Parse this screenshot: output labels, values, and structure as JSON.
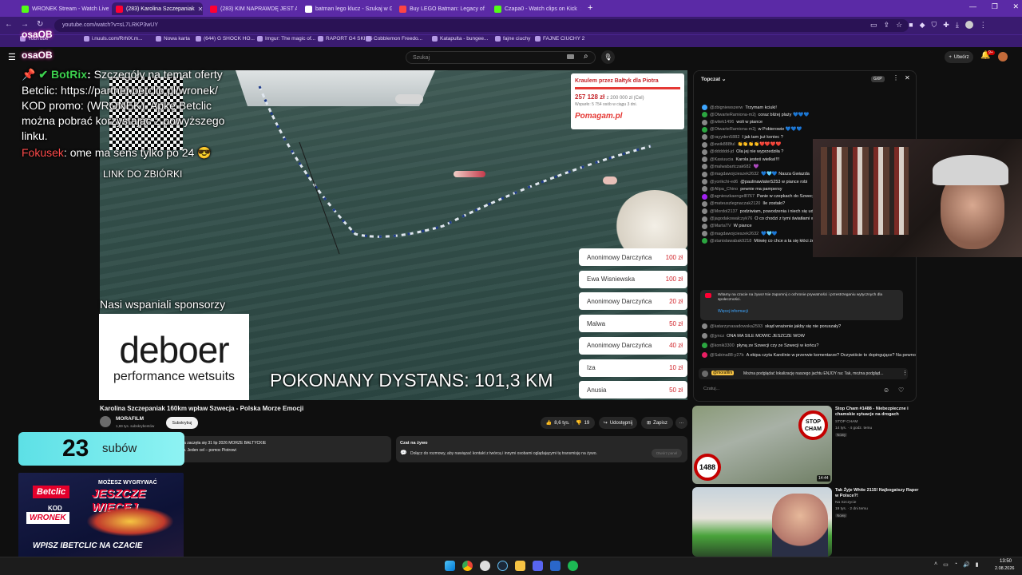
{
  "browser": {
    "tabs": [
      {
        "label": "WRONEK Stream - Watch Live o",
        "color": "#53fc18"
      },
      {
        "label": "(283) Karolina Szczepaniak",
        "color": "#ff0033"
      },
      {
        "label": "(283) KIM NAPRAWDĘ JEST ALB",
        "color": "#ff0033"
      },
      {
        "label": "batman lego klucz - Szukaj w G",
        "color": "#ffffff"
      },
      {
        "label": "Buy LEGO Batman: Legacy of th",
        "color": "#ff4444"
      },
      {
        "label": "Czapa0 - Watch clips on Kick",
        "color": "#53fc18"
      }
    ],
    "new_tab": "+",
    "url": "youtube.com/watch?v=sL7LRKP3wUY",
    "bookmarks": [
      "YouTube",
      "i.nuuls.com/RrhlX.m...",
      "Nowa karta",
      "(644) G SHOCK HO...",
      "Imgur: The magic of...",
      "RAPORT G4 SKINS",
      "Cobblemon Freedo...",
      "Katapulta - bungee...",
      "fajne ciuchy",
      "FAJNE CIUCHY 2"
    ]
  },
  "youtube": {
    "search_placeholder": "Szukaj",
    "create_label": "Utwórz",
    "notif_count": "9+",
    "logo_text": "osaOB"
  },
  "overlay": {
    "bot_name": "BotRix",
    "bot_msg_lines": [
      "Szczegóły na temat oferty",
      "Betclic: https://partner.betclic.pl/wronek/",
      "KOD promo: (WRONEK). Apkę Betclic",
      "można pobrać korzystając z powyższego",
      "linku."
    ],
    "user2_name": "Fokusek",
    "user2_msg": "ome ma sens tylko po 24",
    "qr_caption": "LINK DO ZBIÓRKI",
    "sponsors_text": "Nasi wspaniali sponsorzy",
    "sponsor_logo_main": "deboer",
    "sponsor_logo_sub": "performance wetsuits",
    "distance_text": "POKONANY DYSTANS: 101,3 KM",
    "subs_count": "23",
    "subs_label": "subów",
    "betclic_brand": "Betclic",
    "betclic_code_label": "KOD",
    "betclic_code": "WRONEK",
    "betclic_headline": "MOŻESZ WYGRYWAĆ",
    "betclic_headline2": "JESZCZE WIĘCEJ",
    "betclic_footer": "WPISZ IBETCLIC NA CZACIE"
  },
  "fundraiser": {
    "title": "Kraulem przez Bałtyk dla Piotra",
    "raised": "257 128 zł",
    "goal": "z 200 000 zł (Cel)",
    "supporters": "Wsparło: 5 754 osób w ciągu 3 dni.",
    "brand": "Pomagam.pl",
    "progress": 1.0,
    "donations": [
      {
        "name": "Anonimowy Darczyńca",
        "amount": "100 zł"
      },
      {
        "name": "Ewa Wisniewska",
        "amount": "100 zł"
      },
      {
        "name": "Anonimowy Darczyńca",
        "amount": "20 zł"
      },
      {
        "name": "Malwa",
        "amount": "50 zł"
      },
      {
        "name": "Anonimowy Darczyńca",
        "amount": "40 zł"
      },
      {
        "name": "Iza",
        "amount": "10 zł"
      },
      {
        "name": "Anusia",
        "amount": "50 zł"
      }
    ]
  },
  "video": {
    "title": "Karolina Szczepaniak 160km wpław Szwecja - Polska Morze Emocji",
    "channel": "MORAFILM",
    "subscribers": "1,69 tys. subskrybentów",
    "subscribe_label": "Subskrybuj",
    "likes": "8,6 tys.",
    "dislikes": "19",
    "share_label": "Udostępnij",
    "save_label": "Zapisz",
    "more_label": "···",
    "desc_line1": "ja zaczęła się 31 lip 2026  MORZE BAŁTYCKIE",
    "desc_line2": "u. Jeden cel – pomoc Piotrowi",
    "live_chat_title": "Czat na żywo",
    "live_chat_text": "Dołącz do rozmowy, aby nawiązać kontakt z twórcą i innymi osobami oglądającymi tę transmisję na żywo.",
    "live_chat_btn": "Otwórz panel"
  },
  "chat": {
    "header": "Topczat",
    "messages": [
      {
        "name": "@zbigniewszerw",
        "text": "Trzymam kciuki!",
        "color": "#3ea6ff"
      },
      {
        "name": "@OtwarteRamiona-m2j",
        "text": "coraz bliżej plaży 💙💙💙",
        "color": "#2ba640"
      },
      {
        "name": "@witek1496",
        "text": "woli w piance",
        "color": "#888888"
      },
      {
        "name": "@OtwarteRamiona-m2j",
        "text": "w Pobierowie 💙💙💙",
        "color": "#2ba640"
      },
      {
        "name": "@rayyden5882",
        "text": "I jak tam już koniec ?",
        "color": "#888888"
      },
      {
        "name": "@ewik888ful",
        "text": "👏👏👏👏❤️❤️❤️❤️",
        "color": "#888888"
      },
      {
        "name": "@dddddd-jd",
        "text": "Ola jej nie wyprzedziła ?",
        "color": "#888888"
      },
      {
        "name": "@Kasiuucia",
        "text": "Karola jesteś wielka!!!!",
        "color": "#888888"
      },
      {
        "name": "@malwabartczak682",
        "text": "💜",
        "color": "#888888"
      },
      {
        "name": "@magdawojcieszek2632",
        "text": "💙🩵💙 Nasza Gwiazda",
        "color": "#888888"
      },
      {
        "name": "@yorikchi-ed6",
        "text": "@paulinawlater5253 w piance robi",
        "color": "#888888"
      },
      {
        "name": "@Alipa_Chino",
        "text": "pewnie ma pampersy",
        "color": "#888888"
      },
      {
        "name": "@agnieszkaengel8767",
        "text": "Panie w czepkach do Szwecji",
        "color": "#a020f0"
      },
      {
        "name": "@mateuszlegnaczak2120",
        "text": "Ile zostało?",
        "color": "#888888"
      },
      {
        "name": "@Mordol2137",
        "text": "podziwiam, powodzenia i niech się uda",
        "color": "#888888"
      },
      {
        "name": "@jagodakowalczyk76",
        "text": "O co chodzi z tymi światłami w chodzilo",
        "color": "#888888"
      },
      {
        "name": "@MartaTV",
        "text": "W piance",
        "color": "#888888"
      },
      {
        "name": "@magdawojcieszek2632",
        "text": "💙🩵💙",
        "color": "#888888"
      },
      {
        "name": "@stanislawabak9218",
        "text": "Mówię co chce a ta się kłóci że Roman",
        "color": "#2ba640"
      }
    ],
    "notice": "Witamy na czacie na żywo! Nie zapomnij o ochronie prywatności i przestrzeganiu wytycznych dla społeczności.",
    "notice_link": "Więcej informacji",
    "messages2": [
      {
        "name": "@katarzynasadowska2593",
        "text": "skąd wrażenie jakby się nie poruszały?",
        "color": "#888888"
      },
      {
        "name": "@jyncz",
        "text": "ONA MA SILE MOWIC JESZCZE WOW",
        "color": "#888888"
      },
      {
        "name": "@konik3300",
        "text": "płyną ze Szwecji czy ze Szwecji w końcu?",
        "color": "#2ba640"
      },
      {
        "name": "@Sabina88-y27b",
        "text": "A ekipa czyta Karolinie w przerwie komentarze? Oczywiście to dopingujące? Na pewno dało by to jej dodatkowego powera 😊",
        "color": "#e91e63"
      }
    ],
    "pinned_name": "@morafilm",
    "pinned_text": "Można podglądać lokalizację naszego jachtu ENJOY na: Tak, można podgląd...",
    "input_placeholder": "Czatuj..."
  },
  "recommendations": [
    {
      "title": "Stop Cham #1488 - Niebezpieczne i chamskie sytuacje na drogach",
      "channel": "STOP CHAM",
      "meta": "14 tys. · 4 godz. temu",
      "badge": "Nowy",
      "duration": "14:44",
      "badge_text": "STOP CHAM",
      "number": "1488"
    },
    {
      "title": "Tak Żyje White 2115! Najbogatszy Raper w Polsce?!",
      "channel": "Na Szczycie",
      "meta": "19 tys. · 2 dni temu",
      "badge": "Nowy",
      "duration": "",
      "badge_text": "",
      "number": ""
    }
  ],
  "taskbar": {
    "time": "13:50",
    "date": "2.08.2026"
  }
}
